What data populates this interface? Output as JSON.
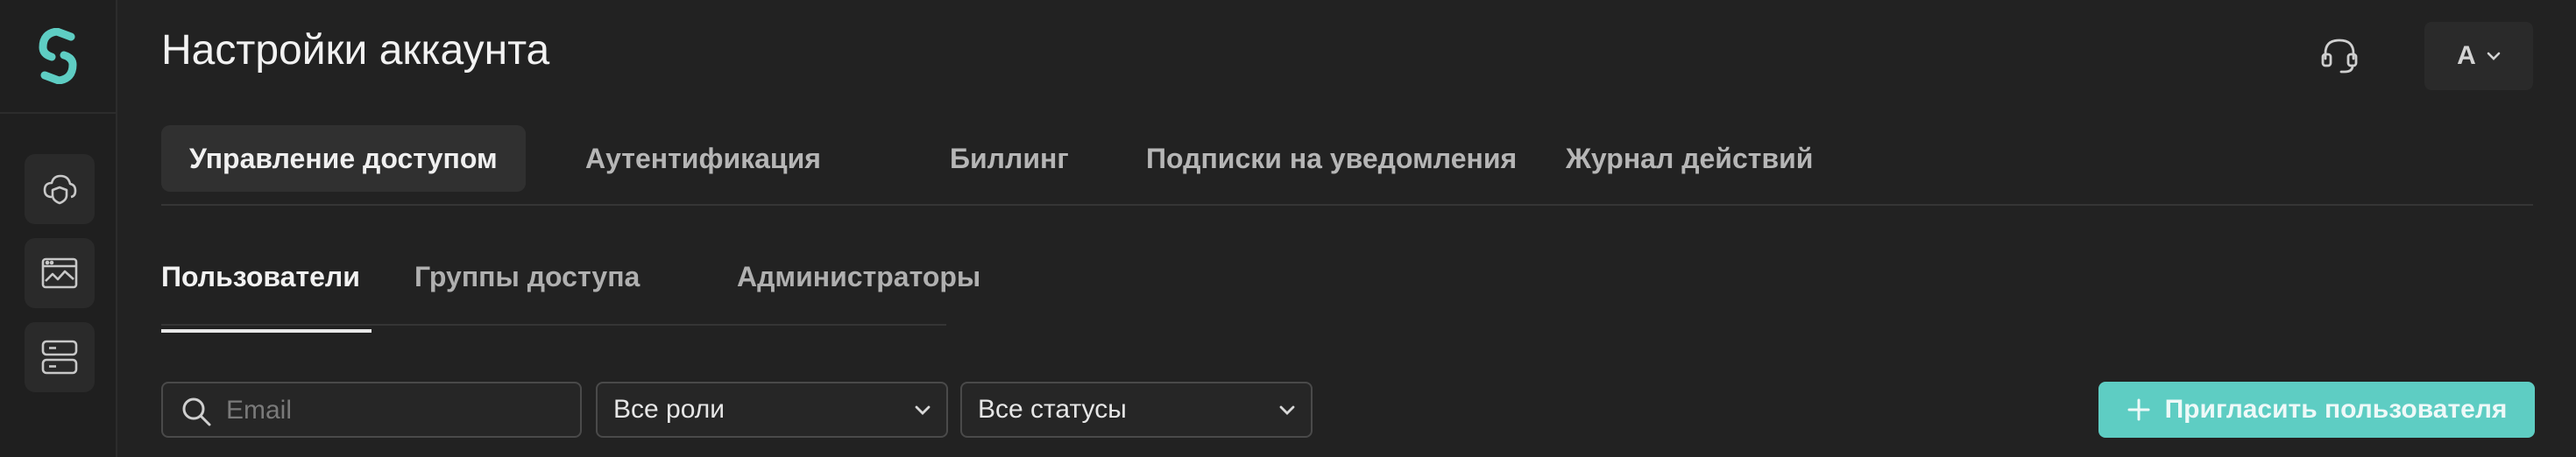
{
  "page": {
    "title": "Настройки аккаунта"
  },
  "header": {
    "account_initial": "A"
  },
  "sidebar": {
    "items": [
      {
        "icon": "cloud-shield-icon"
      },
      {
        "icon": "monitoring-window-icon"
      },
      {
        "icon": "server-icon"
      }
    ]
  },
  "tabs": [
    {
      "label": "Управление доступом",
      "active": true
    },
    {
      "label": "Аутентификация",
      "active": false
    },
    {
      "label": "Биллинг",
      "active": false
    },
    {
      "label": "Подписки на уведомления",
      "active": false
    },
    {
      "label": "Журнал действий",
      "active": false
    }
  ],
  "subtabs": [
    {
      "label": "Пользователи",
      "active": true
    },
    {
      "label": "Группы доступа",
      "active": false
    },
    {
      "label": "Администраторы",
      "active": false
    }
  ],
  "filters": {
    "search_placeholder": "Email",
    "search_value": "",
    "role_select": "Все роли",
    "status_select": "Все статусы"
  },
  "actions": {
    "invite_label": "Пригласить пользователя"
  },
  "colors": {
    "accent": "#5ecdc3",
    "background": "#222222",
    "sidebar": "#1f1f1f"
  }
}
